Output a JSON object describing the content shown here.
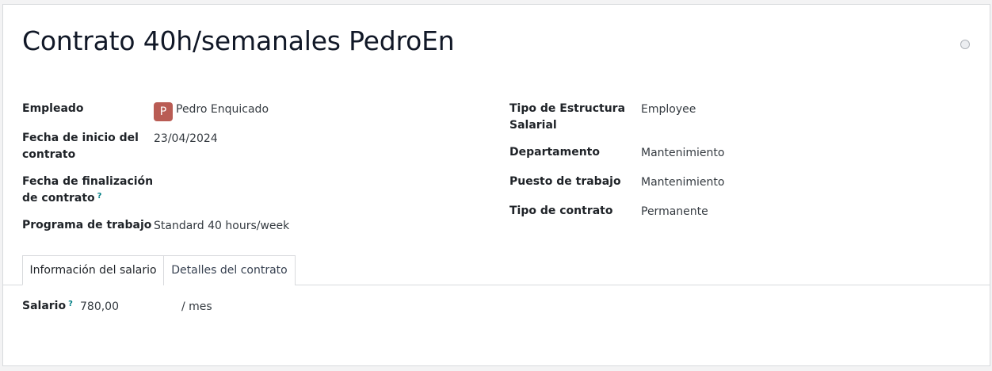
{
  "record": {
    "title": "Contrato 40h/semanales PedroEn"
  },
  "form": {
    "left": {
      "employee_label": "Empleado",
      "employee_avatar": "P",
      "employee_value": "Pedro Enquicado",
      "start_label_1": "Fecha de inicio del",
      "start_label_2": "contrato",
      "start_value": "23/04/2024",
      "end_label_1": "Fecha de finalización",
      "end_label_2": "de contrato",
      "end_help": "?",
      "schedule_label": "Programa de trabajo",
      "schedule_value": "Standard 40 hours/week"
    },
    "right": {
      "structure_label_1": "Tipo de Estructura",
      "structure_label_2": "Salarial",
      "structure_value": "Employee",
      "department_label": "Departamento",
      "department_value": "Mantenimiento",
      "job_label": "Puesto de trabajo",
      "job_value": "Mantenimiento",
      "contract_type_label": "Tipo de contrato",
      "contract_type_value": "Permanente"
    }
  },
  "tabs": [
    {
      "label": "Información del salario",
      "active": true
    },
    {
      "label": "Detalles del contrato",
      "active": false
    }
  ],
  "salary": {
    "label": "Salario",
    "help": "?",
    "value": "780,00",
    "period": "/ mes"
  }
}
